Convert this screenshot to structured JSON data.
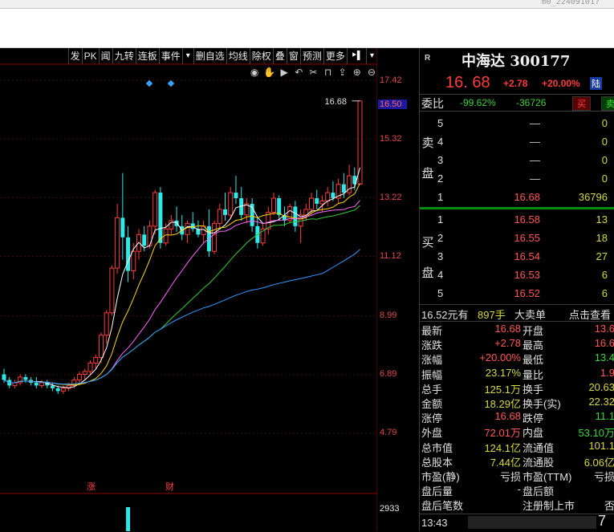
{
  "window": {
    "corner_text": "m0_22409101?"
  },
  "toolbar": {
    "items": [
      "发",
      "PK",
      "闻",
      "九转",
      "连板",
      "事件",
      "▾",
      "删自选",
      "均线",
      "除权",
      "叠",
      "窗",
      "预测",
      "更多",
      "⯈▌",
      "▾"
    ],
    "tools": [
      "eye-icon",
      "hand-icon",
      "play-icon",
      "undo-icon",
      "scissors-icon",
      "lock-icon",
      "export-icon",
      "zoom-in-icon",
      "zoom-out-icon"
    ]
  },
  "price_axis": {
    "labels": [
      "17.42",
      "16.50",
      "15.32",
      "13.22",
      "11.12",
      "8.99",
      "6.89",
      "4.79"
    ],
    "highlight": "16.50",
    "high_marker": "16.68"
  },
  "volume_axis": {
    "labels": [
      "2933"
    ]
  },
  "event_markers": [
    "涨",
    "财"
  ],
  "chart_data": {
    "type": "candlestick",
    "ylim": [
      4.0,
      17.8
    ],
    "series_ohlc_note": "daily candles",
    "candles": [
      [
        6.9,
        7.1,
        6.6,
        6.7
      ],
      [
        6.7,
        6.8,
        6.4,
        6.5
      ],
      [
        6.5,
        6.7,
        6.4,
        6.6
      ],
      [
        6.6,
        6.9,
        6.5,
        6.8
      ],
      [
        6.8,
        6.9,
        6.6,
        6.7
      ],
      [
        6.7,
        6.8,
        6.5,
        6.6
      ],
      [
        6.6,
        6.8,
        6.4,
        6.5
      ],
      [
        6.5,
        6.7,
        6.4,
        6.6
      ],
      [
        6.6,
        6.7,
        6.4,
        6.5
      ],
      [
        6.5,
        6.6,
        6.3,
        6.4
      ],
      [
        6.4,
        6.5,
        6.2,
        6.3
      ],
      [
        6.3,
        6.5,
        6.2,
        6.4
      ],
      [
        6.4,
        6.6,
        6.3,
        6.5
      ],
      [
        6.5,
        6.8,
        6.4,
        6.7
      ],
      [
        6.7,
        7.0,
        6.5,
        6.9
      ],
      [
        6.9,
        7.1,
        6.7,
        7.0
      ],
      [
        7.0,
        7.4,
        6.9,
        7.3
      ],
      [
        7.3,
        7.6,
        7.1,
        7.5
      ],
      [
        7.5,
        8.4,
        7.3,
        8.3
      ],
      [
        8.3,
        9.2,
        8.0,
        9.1
      ],
      [
        9.1,
        10.8,
        9.0,
        10.7
      ],
      [
        10.7,
        13.0,
        10.5,
        12.5
      ],
      [
        12.5,
        14.1,
        11.0,
        11.8
      ],
      [
        11.8,
        12.2,
        10.2,
        10.6
      ],
      [
        10.6,
        11.6,
        10.3,
        11.3
      ],
      [
        11.3,
        12.1,
        11.0,
        11.9
      ],
      [
        11.9,
        12.2,
        11.3,
        11.5
      ],
      [
        11.5,
        12.4,
        11.4,
        12.2
      ],
      [
        12.2,
        13.5,
        11.9,
        13.4
      ],
      [
        13.4,
        13.6,
        11.4,
        11.6
      ],
      [
        11.6,
        12.3,
        11.5,
        12.1
      ],
      [
        12.1,
        12.6,
        11.9,
        12.4
      ],
      [
        12.4,
        12.9,
        12.0,
        12.2
      ],
      [
        12.2,
        12.6,
        11.7,
        11.9
      ],
      [
        11.9,
        12.4,
        11.6,
        12.3
      ],
      [
        12.3,
        12.7,
        12.0,
        12.1
      ],
      [
        12.1,
        12.4,
        11.8,
        11.9
      ],
      [
        11.9,
        12.4,
        11.6,
        12.2
      ],
      [
        12.2,
        12.8,
        11.1,
        11.3
      ],
      [
        11.3,
        12.4,
        11.2,
        12.3
      ],
      [
        12.3,
        13.0,
        12.1,
        12.8
      ],
      [
        12.8,
        13.4,
        12.4,
        12.6
      ],
      [
        12.6,
        13.6,
        12.5,
        13.4
      ],
      [
        13.4,
        14.0,
        13.0,
        13.2
      ],
      [
        13.2,
        13.6,
        12.4,
        12.6
      ],
      [
        12.6,
        13.2,
        12.3,
        13.0
      ],
      [
        13.0,
        13.2,
        12.0,
        12.2
      ],
      [
        12.2,
        12.5,
        11.4,
        11.6
      ],
      [
        11.6,
        12.3,
        11.5,
        12.1
      ],
      [
        12.1,
        12.9,
        11.9,
        12.7
      ],
      [
        12.7,
        13.4,
        12.6,
        13.2
      ],
      [
        13.2,
        13.3,
        12.4,
        12.6
      ],
      [
        12.6,
        12.9,
        12.2,
        12.4
      ],
      [
        12.4,
        13.0,
        12.3,
        12.9
      ],
      [
        12.9,
        13.1,
        12.0,
        12.2
      ],
      [
        12.2,
        12.8,
        11.6,
        12.6
      ],
      [
        12.6,
        13.0,
        12.4,
        12.8
      ],
      [
        12.8,
        13.4,
        12.6,
        13.2
      ],
      [
        13.2,
        13.5,
        12.8,
        13.0
      ],
      [
        13.0,
        13.3,
        12.7,
        13.1
      ],
      [
        13.1,
        13.6,
        12.9,
        13.4
      ],
      [
        13.4,
        13.8,
        13.1,
        13.2
      ],
      [
        13.2,
        13.9,
        13.0,
        13.7
      ],
      [
        13.7,
        14.1,
        13.2,
        13.4
      ],
      [
        13.4,
        14.4,
        13.3,
        14.0
      ],
      [
        14.0,
        14.3,
        13.5,
        13.7
      ],
      [
        13.7,
        16.68,
        13.7,
        16.68
      ]
    ],
    "ma_colors": [
      "#ffffff",
      "#ffd700",
      "#ff66ff",
      "#33cc33",
      "#3399ff"
    ],
    "volumes": [
      0,
      0,
      0,
      0,
      0,
      0,
      0,
      0,
      0,
      0,
      0,
      0,
      0,
      0,
      0,
      0,
      0,
      0,
      0,
      0,
      0,
      0,
      0,
      2933,
      0,
      0,
      0,
      0,
      0,
      0,
      0,
      0,
      0,
      0,
      0,
      0,
      0,
      0,
      0,
      0,
      0,
      0,
      0,
      0,
      0,
      0,
      0,
      0,
      0,
      0,
      0,
      0,
      0,
      0,
      0,
      0,
      0,
      0,
      0,
      0,
      0,
      0,
      0,
      0,
      0,
      0,
      0
    ]
  },
  "quote": {
    "market": "R",
    "name": "中海达 300177",
    "price": "16. 68",
    "change": "+2.78",
    "pct": "+20.00%",
    "tag": "陆"
  },
  "weibi": {
    "label": "委比",
    "ratio": "-99.62%",
    "diff": "-36726",
    "buy": "买",
    "sell": "卖"
  },
  "ask": {
    "label": "卖盘",
    "rows": [
      {
        "lv": "5",
        "price": "—",
        "vol": "0"
      },
      {
        "lv": "4",
        "price": "—",
        "vol": "0"
      },
      {
        "lv": "3",
        "price": "—",
        "vol": "0"
      },
      {
        "lv": "2",
        "price": "—",
        "vol": "0"
      },
      {
        "lv": "1",
        "price": "16.68",
        "vol": "36796"
      }
    ]
  },
  "bid": {
    "label": "买盘",
    "rows": [
      {
        "lv": "1",
        "price": "16.58",
        "vol": "13"
      },
      {
        "lv": "2",
        "price": "16.55",
        "vol": "18"
      },
      {
        "lv": "3",
        "price": "16.54",
        "vol": "27"
      },
      {
        "lv": "4",
        "price": "16.53",
        "vol": "6"
      },
      {
        "lv": "5",
        "price": "16.52",
        "vol": "6"
      }
    ]
  },
  "trade": {
    "a": "16.52元有",
    "b": "897手",
    "c": "大卖单",
    "d": "点击查看"
  },
  "stats": {
    "left": [
      {
        "k": "最新",
        "v": "16.68",
        "c": "#ff5555"
      },
      {
        "k": "涨跌",
        "v": "+2.78",
        "c": "#ff5555"
      },
      {
        "k": "涨幅",
        "v": "+20.00%",
        "c": "#ff5555"
      },
      {
        "k": "振幅",
        "v": "23.17%",
        "c": "#d8d840"
      },
      {
        "k": "总手",
        "v": "125.1万",
        "c": "#d8d840"
      },
      {
        "k": "金额",
        "v": "18.29亿",
        "c": "#d8d840"
      },
      {
        "k": "涨停",
        "v": "16.68",
        "c": "#ff5555"
      },
      {
        "k": "外盘",
        "v": "72.01万",
        "c": "#ff5555"
      },
      {
        "k": "总市值",
        "v": "124.1亿",
        "c": "#d8d840"
      },
      {
        "k": "总股本",
        "v": "7.44亿",
        "c": "#d8d840"
      },
      {
        "k": "市盈(静)",
        "v": "亏损",
        "c": "#e0e0e0"
      },
      {
        "k": "盘后量",
        "v": "-",
        "c": "#e0e0e0"
      },
      {
        "k": "盘后笔数",
        "v": "",
        "c": "#e0e0e0"
      }
    ],
    "right": [
      {
        "k": "开盘",
        "v": "13.6",
        "c": "#ff5555"
      },
      {
        "k": "最高",
        "v": "16.6",
        "c": "#ff5555"
      },
      {
        "k": "最低",
        "v": "13.4",
        "c": "#3dd13d"
      },
      {
        "k": "量比",
        "v": "1.9",
        "c": "#ff5555"
      },
      {
        "k": "换手",
        "v": "20.63",
        "c": "#d8d840"
      },
      {
        "k": "换手(实)",
        "v": "22.32",
        "c": "#d8d840"
      },
      {
        "k": "跌停",
        "v": "11.1",
        "c": "#3dd13d"
      },
      {
        "k": "内盘",
        "v": "53.10万",
        "c": "#3dd13d"
      },
      {
        "k": "流通值",
        "v": "101.1",
        "c": "#d8d840"
      },
      {
        "k": "流通股",
        "v": "6.06亿",
        "c": "#d8d840"
      },
      {
        "k": "市盈(TTM)",
        "v": "亏损",
        "c": "#e0e0e0"
      },
      {
        "k": "盘后额",
        "v": "",
        "c": "#e0e0e0"
      },
      {
        "k": "注册制上市",
        "v": "否",
        "c": "#e0e0e0"
      }
    ]
  },
  "bottom": {
    "time": "13:43",
    "num": "7"
  }
}
